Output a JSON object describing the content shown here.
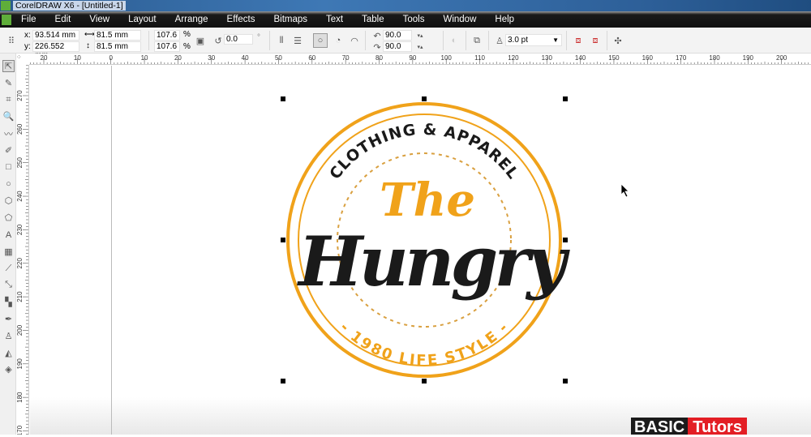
{
  "title": "CorelDRAW X6 - [Untitled-1]",
  "menu": [
    "File",
    "Edit",
    "View",
    "Layout",
    "Arrange",
    "Effects",
    "Bitmaps",
    "Text",
    "Table",
    "Tools",
    "Window",
    "Help"
  ],
  "props": {
    "x_label": "x:",
    "x": "93.514 mm",
    "y_label": "y:",
    "y": "226.552 mm",
    "w": "81.5 mm",
    "h": "81.5 mm",
    "sx": "107.6",
    "sy": "107.6",
    "pct": "%",
    "rot": "0.0",
    "deg": "°",
    "ang1": "90.0",
    "ang2": "90.0",
    "outline": "3.0 pt"
  },
  "ruler": {
    "h": [
      "20",
      "10",
      "0",
      "10",
      "20",
      "30",
      "40",
      "50",
      "60",
      "70",
      "80",
      "90",
      "100",
      "110",
      "120",
      "130",
      "140",
      "150",
      "160",
      "170",
      "180",
      "190",
      "200"
    ],
    "v": [
      "270",
      "260",
      "250",
      "240",
      "230",
      "220",
      "210",
      "200",
      "190",
      "180",
      "170"
    ],
    "units": "mm"
  },
  "tools": [
    "pick-tool",
    "shape-tool",
    "crop-tool",
    "zoom-tool",
    "freehand-tool",
    "smart-fill-tool",
    "rectangle-tool",
    "ellipse-tool",
    "polygon-tool",
    "basic-shapes-tool",
    "text-tool",
    "table-tool",
    "parallel-dimension-tool",
    "connector-tool",
    "blend-tool",
    "eyedropper-tool",
    "outline-pen-tool",
    "fill-tool",
    "interactive-fill-tool"
  ],
  "logo": {
    "top": "CLOTHING & APPAREL",
    "the": "The",
    "hungry": "Hungry",
    "bottom": "- 1980 LIFE STYLE -",
    "accent": "#f0a21a",
    "dark": "#1a1a1a"
  },
  "watermark": {
    "a": "BASIC",
    "b": "Tutors"
  }
}
